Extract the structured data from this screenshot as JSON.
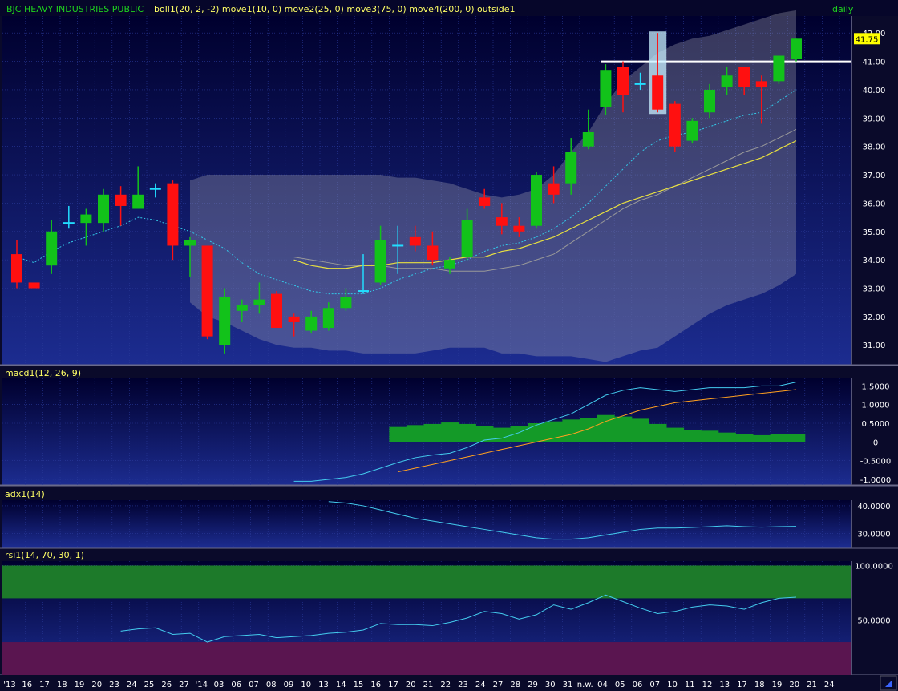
{
  "header": {
    "instrument": "BJC HEAVY INDUSTRIES PUBLIC",
    "indicators": "boll1(20, 2, -2) move1(10, 0) move2(25, 0) move3(75, 0) move4(200, 0) outside1",
    "interval": "daily",
    "last_price_tag": "41.75"
  },
  "panels": {
    "macd": {
      "label": "macd1(12, 26, 9)",
      "ticks": [
        "1.5000",
        "1.0000",
        "0.5000",
        "0",
        "-0.5000",
        "-1.0000"
      ],
      "tick_values": [
        1.5,
        1.0,
        0.5,
        0,
        -0.5,
        -1.0
      ]
    },
    "adx": {
      "label": "adx1(14)",
      "ticks": [
        "40.0000",
        "30.0000"
      ],
      "tick_values": [
        40,
        30
      ]
    },
    "rsi": {
      "label": "rsi1(14, 70, 30, 1)",
      "ticks": [
        "100.0000",
        "50.0000"
      ],
      "tick_values": [
        100,
        50
      ]
    }
  },
  "time_axis": {
    "labels": [
      "'13",
      "16",
      "17",
      "18",
      "19",
      "20",
      "23",
      "24",
      "25",
      "26",
      "27",
      "'14",
      "03",
      "06",
      "07",
      "08",
      "09",
      "10",
      "13",
      "14",
      "15",
      "16",
      "17",
      "20",
      "21",
      "22",
      "23",
      "24",
      "27",
      "28",
      "29",
      "30",
      "31",
      "n.w.",
      "04",
      "05",
      "06",
      "07",
      "10",
      "11",
      "12",
      "13",
      "17",
      "18",
      "19",
      "20",
      "21",
      "24"
    ]
  },
  "colors": {
    "up": "#12c21a",
    "down": "#ff1010",
    "doji": "#22ddff",
    "bg_top": "#00003a",
    "bg_bottom": "#1a2a8c",
    "ma10": "#33c8e8",
    "ma25": "#e8e040",
    "ma75": "#999999",
    "macd": "#44ccee",
    "signal": "#ffa020",
    "rsi_over": "#1d7a2a",
    "rsi_under": "#5a1550"
  },
  "chart_data": {
    "type": "candlestick",
    "title": "BJC HEAVY INDUSTRIES PUBLIC",
    "price_axis": {
      "ticks": [
        "42.00",
        "41.00",
        "40.00",
        "39.00",
        "38.00",
        "37.00",
        "36.00",
        "35.00",
        "34.00",
        "33.00",
        "32.00",
        "31.00"
      ],
      "range": [
        30.3,
        42.6
      ]
    },
    "candles": [
      {
        "o": 34.2,
        "h": 34.7,
        "l": 33.0,
        "c": 33.2
      },
      {
        "o": 33.2,
        "h": 33.2,
        "l": 33.0,
        "c": 33.0
      },
      {
        "o": 33.8,
        "h": 35.4,
        "l": 33.5,
        "c": 35.0
      },
      {
        "o": 35.3,
        "h": 35.9,
        "l": 35.1,
        "c": 35.3
      },
      {
        "o": 35.3,
        "h": 35.8,
        "l": 34.5,
        "c": 35.6
      },
      {
        "o": 35.3,
        "h": 36.5,
        "l": 35.0,
        "c": 36.3
      },
      {
        "o": 36.3,
        "h": 36.6,
        "l": 35.2,
        "c": 35.9
      },
      {
        "o": 35.8,
        "h": 37.3,
        "l": 35.8,
        "c": 36.3
      },
      {
        "o": 36.5,
        "h": 36.7,
        "l": 36.2,
        "c": 36.5
      },
      {
        "o": 36.7,
        "h": 36.8,
        "l": 34.0,
        "c": 34.5
      },
      {
        "o": 34.5,
        "h": 34.8,
        "l": 33.4,
        "c": 34.7
      },
      {
        "o": 34.5,
        "h": 34.5,
        "l": 31.2,
        "c": 31.3
      },
      {
        "o": 31.0,
        "h": 33.0,
        "l": 30.7,
        "c": 32.7
      },
      {
        "o": 32.2,
        "h": 32.6,
        "l": 31.8,
        "c": 32.4
      },
      {
        "o": 32.4,
        "h": 33.2,
        "l": 32.1,
        "c": 32.6
      },
      {
        "o": 32.8,
        "h": 32.9,
        "l": 31.6,
        "c": 31.6
      },
      {
        "o": 32.0,
        "h": 32.1,
        "l": 31.3,
        "c": 31.8
      },
      {
        "o": 31.5,
        "h": 32.2,
        "l": 31.4,
        "c": 32.0
      },
      {
        "o": 31.6,
        "h": 32.5,
        "l": 31.5,
        "c": 32.3
      },
      {
        "o": 32.3,
        "h": 33.0,
        "l": 32.2,
        "c": 32.7
      },
      {
        "o": 32.9,
        "h": 34.2,
        "l": 32.8,
        "c": 32.9
      },
      {
        "o": 33.2,
        "h": 35.2,
        "l": 33.1,
        "c": 34.7
      },
      {
        "o": 34.5,
        "h": 35.2,
        "l": 33.5,
        "c": 34.5
      },
      {
        "o": 34.8,
        "h": 35.2,
        "l": 34.3,
        "c": 34.5
      },
      {
        "o": 34.5,
        "h": 35.0,
        "l": 33.8,
        "c": 34.0
      },
      {
        "o": 33.7,
        "h": 34.1,
        "l": 33.5,
        "c": 34.0
      },
      {
        "o": 34.1,
        "h": 35.8,
        "l": 34.0,
        "c": 35.4
      },
      {
        "o": 36.2,
        "h": 36.5,
        "l": 35.8,
        "c": 35.9
      },
      {
        "o": 35.5,
        "h": 36.0,
        "l": 34.9,
        "c": 35.2
      },
      {
        "o": 35.2,
        "h": 35.5,
        "l": 34.8,
        "c": 35.0
      },
      {
        "o": 35.2,
        "h": 37.1,
        "l": 35.1,
        "c": 37.0
      },
      {
        "o": 36.7,
        "h": 37.3,
        "l": 36.0,
        "c": 36.3
      },
      {
        "o": 36.7,
        "h": 38.3,
        "l": 36.3,
        "c": 37.8
      },
      {
        "o": 38.0,
        "h": 39.3,
        "l": 37.9,
        "c": 38.5
      },
      {
        "o": 39.4,
        "h": 40.9,
        "l": 39.1,
        "c": 40.7
      },
      {
        "o": 40.8,
        "h": 41.0,
        "l": 39.2,
        "c": 39.8
      },
      {
        "o": 40.2,
        "h": 40.6,
        "l": 40.0,
        "c": 40.2
      },
      {
        "o": 40.5,
        "h": 42.0,
        "l": 39.2,
        "c": 39.3
      },
      {
        "o": 39.5,
        "h": 39.6,
        "l": 37.8,
        "c": 38.0
      },
      {
        "o": 38.2,
        "h": 39.0,
        "l": 38.1,
        "c": 38.9
      },
      {
        "o": 39.2,
        "h": 40.2,
        "l": 39.0,
        "c": 40.0
      },
      {
        "o": 40.1,
        "h": 40.8,
        "l": 39.8,
        "c": 40.5
      },
      {
        "o": 40.8,
        "h": 40.8,
        "l": 39.8,
        "c": 40.1
      },
      {
        "o": 40.3,
        "h": 40.5,
        "l": 38.8,
        "c": 40.1
      },
      {
        "o": 40.3,
        "h": 41.2,
        "l": 40.2,
        "c": 41.2
      },
      {
        "o": 41.1,
        "h": 41.8,
        "l": 41.0,
        "c": 41.8
      }
    ],
    "bollinger_upper": [
      null,
      null,
      null,
      null,
      null,
      null,
      null,
      null,
      null,
      null,
      36.8,
      37.0,
      37.0,
      37.0,
      37.0,
      37.0,
      37.0,
      37.0,
      37.0,
      37.0,
      37.0,
      37.0,
      36.9,
      36.9,
      36.8,
      36.7,
      36.5,
      36.3,
      36.2,
      36.3,
      36.5,
      37.0,
      37.8,
      38.5,
      39.5,
      40.3,
      40.8,
      41.3,
      41.6,
      41.8,
      41.9,
      42.1,
      42.3,
      42.5,
      42.7,
      42.8
    ],
    "bollinger_lower": [
      null,
      null,
      null,
      null,
      null,
      null,
      null,
      null,
      null,
      null,
      32.5,
      32.0,
      31.8,
      31.5,
      31.2,
      31.0,
      30.9,
      30.9,
      30.8,
      30.8,
      30.7,
      30.7,
      30.7,
      30.7,
      30.8,
      30.9,
      30.9,
      30.9,
      30.7,
      30.7,
      30.6,
      30.6,
      30.6,
      30.5,
      30.4,
      30.6,
      30.8,
      30.9,
      31.3,
      31.7,
      32.1,
      32.4,
      32.6,
      32.8,
      33.1,
      33.5
    ],
    "ma10": [
      34.1,
      33.9,
      34.3,
      34.6,
      34.8,
      35.0,
      35.2,
      35.5,
      35.4,
      35.2,
      35.0,
      34.7,
      34.4,
      33.9,
      33.5,
      33.3,
      33.1,
      32.9,
      32.8,
      32.8,
      32.8,
      33.0,
      33.3,
      33.5,
      33.7,
      33.8,
      34.0,
      34.3,
      34.5,
      34.6,
      34.8,
      35.1,
      35.5,
      36.0,
      36.6,
      37.2,
      37.8,
      38.2,
      38.4,
      38.5,
      38.7,
      38.9,
      39.1,
      39.2,
      39.6,
      40.0
    ],
    "ma25": [
      null,
      null,
      null,
      null,
      null,
      null,
      null,
      null,
      null,
      null,
      null,
      null,
      null,
      null,
      null,
      null,
      34.0,
      33.8,
      33.7,
      33.7,
      33.8,
      33.8,
      33.9,
      33.9,
      33.9,
      34.0,
      34.1,
      34.1,
      34.3,
      34.4,
      34.6,
      34.8,
      35.1,
      35.4,
      35.7,
      36.0,
      36.2,
      36.4,
      36.6,
      36.8,
      37.0,
      37.2,
      37.4,
      37.6,
      37.9,
      38.2
    ],
    "ma75": [
      null,
      null,
      null,
      null,
      null,
      null,
      null,
      null,
      null,
      null,
      null,
      null,
      null,
      null,
      null,
      null,
      34.1,
      34.0,
      33.9,
      33.8,
      33.8,
      33.8,
      33.7,
      33.7,
      33.7,
      33.6,
      33.6,
      33.6,
      33.7,
      33.8,
      34.0,
      34.2,
      34.6,
      35.0,
      35.4,
      35.8,
      36.1,
      36.3,
      36.6,
      36.9,
      37.2,
      37.5,
      37.8,
      38.0,
      38.3,
      38.6
    ],
    "resistance_line": 41.0,
    "macd_line": [
      null,
      null,
      null,
      null,
      null,
      null,
      null,
      null,
      null,
      null,
      null,
      null,
      null,
      null,
      null,
      null,
      -1.05,
      -1.05,
      -1.0,
      -0.95,
      -0.85,
      -0.7,
      -0.55,
      -0.42,
      -0.35,
      -0.3,
      -0.15,
      0.05,
      0.1,
      0.25,
      0.45,
      0.6,
      0.75,
      1.0,
      1.25,
      1.38,
      1.45,
      1.4,
      1.35,
      1.4,
      1.45,
      1.45,
      1.45,
      1.5,
      1.5,
      1.6
    ],
    "signal_line": [
      null,
      null,
      null,
      null,
      null,
      null,
      null,
      null,
      null,
      null,
      null,
      null,
      null,
      null,
      null,
      null,
      null,
      null,
      null,
      null,
      null,
      null,
      -0.8,
      -0.7,
      -0.6,
      -0.5,
      -0.4,
      -0.3,
      -0.2,
      -0.1,
      0.0,
      0.1,
      0.2,
      0.35,
      0.55,
      0.7,
      0.85,
      0.95,
      1.05,
      1.1,
      1.15,
      1.2,
      1.25,
      1.3,
      1.35,
      1.4
    ],
    "macd_hist": [
      null,
      null,
      null,
      null,
      null,
      null,
      null,
      null,
      null,
      null,
      null,
      null,
      null,
      null,
      null,
      null,
      null,
      null,
      null,
      null,
      null,
      null,
      0.4,
      0.45,
      0.48,
      0.52,
      0.48,
      0.42,
      0.38,
      0.42,
      0.5,
      0.55,
      0.6,
      0.65,
      0.72,
      0.68,
      0.62,
      0.48,
      0.38,
      0.32,
      0.3,
      0.25,
      0.2,
      0.18,
      0.2,
      0.2
    ],
    "adx": [
      null,
      null,
      null,
      null,
      null,
      null,
      null,
      null,
      null,
      null,
      null,
      null,
      null,
      null,
      null,
      null,
      null,
      null,
      41.5,
      41.0,
      40.0,
      38.5,
      37.0,
      35.5,
      34.5,
      33.5,
      32.5,
      31.5,
      30.5,
      29.5,
      28.5,
      28.0,
      28.0,
      28.5,
      29.5,
      30.5,
      31.5,
      32.0,
      32.0,
      32.2,
      32.5,
      32.8,
      32.5,
      32.3,
      32.5,
      32.6
    ],
    "rsi": [
      null,
      null,
      null,
      null,
      null,
      null,
      40.0,
      42.0,
      43.0,
      37.0,
      38.0,
      30.0,
      35.0,
      36.0,
      37.0,
      34.0,
      35.0,
      36.0,
      38.0,
      39.0,
      41.0,
      47.0,
      46.0,
      46.0,
      45.0,
      48.0,
      52.0,
      58.0,
      56.0,
      51.0,
      55.0,
      64.0,
      60.0,
      66.0,
      73.0,
      67.0,
      61.0,
      56.0,
      58.0,
      62.0,
      64.0,
      63.0,
      60.0,
      66.0,
      70.0,
      71.0
    ],
    "rsi_levels": [
      70,
      30
    ]
  }
}
